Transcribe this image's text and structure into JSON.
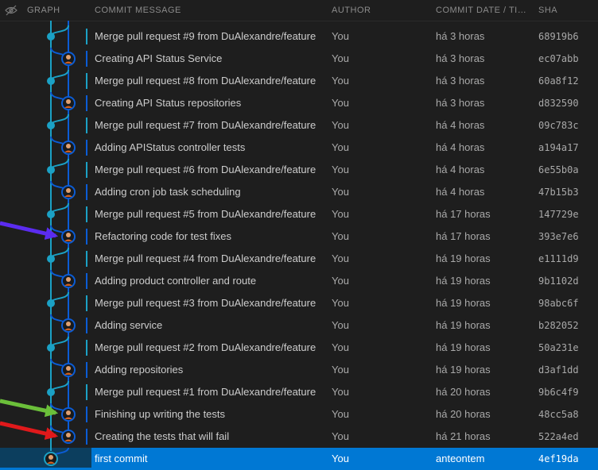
{
  "header": {
    "graph": "GRAPH",
    "message": "COMMIT MESSAGE",
    "author": "AUTHOR",
    "date": "COMMIT DATE / TI…",
    "sha": "SHA"
  },
  "commits": [
    {
      "message": "Merge pull request #9 from DuAlexandre/feature",
      "author": "You",
      "date": "há 3 horas",
      "sha": "68919b6",
      "type": "merge"
    },
    {
      "message": "Creating API Status Service",
      "author": "You",
      "date": "há 3 horas",
      "sha": "ec07abb",
      "type": "commit"
    },
    {
      "message": "Merge pull request #8 from DuAlexandre/feature",
      "author": "You",
      "date": "há 3 horas",
      "sha": "60a8f12",
      "type": "merge"
    },
    {
      "message": "Creating API Status repositories",
      "author": "You",
      "date": "há 3 horas",
      "sha": "d832590",
      "type": "commit"
    },
    {
      "message": "Merge pull request #7 from DuAlexandre/feature",
      "author": "You",
      "date": "há 4 horas",
      "sha": "09c783c",
      "type": "merge"
    },
    {
      "message": "Adding APIStatus controller tests",
      "author": "You",
      "date": "há 4 horas",
      "sha": "a194a17",
      "type": "commit"
    },
    {
      "message": "Merge pull request #6 from DuAlexandre/feature",
      "author": "You",
      "date": "há 4 horas",
      "sha": "6e55b0a",
      "type": "merge"
    },
    {
      "message": "Adding cron job task scheduling",
      "author": "You",
      "date": "há 4 horas",
      "sha": "47b15b3",
      "type": "commit"
    },
    {
      "message": "Merge pull request #5 from DuAlexandre/feature",
      "author": "You",
      "date": "há 17 horas",
      "sha": "147729e",
      "type": "merge"
    },
    {
      "message": "Refactoring code for test fixes",
      "author": "You",
      "date": "há 17 horas",
      "sha": "393e7e6",
      "type": "commit"
    },
    {
      "message": "Merge pull request #4 from DuAlexandre/feature",
      "author": "You",
      "date": "há 19 horas",
      "sha": "e1111d9",
      "type": "merge"
    },
    {
      "message": "Adding product controller and route",
      "author": "You",
      "date": "há 19 horas",
      "sha": "9b1102d",
      "type": "commit"
    },
    {
      "message": "Merge pull request #3 from DuAlexandre/feature",
      "author": "You",
      "date": "há 19 horas",
      "sha": "98abc6f",
      "type": "merge"
    },
    {
      "message": "Adding service",
      "author": "You",
      "date": "há 19 horas",
      "sha": "b282052",
      "type": "commit"
    },
    {
      "message": "Merge pull request #2 from DuAlexandre/feature",
      "author": "You",
      "date": "há 19 horas",
      "sha": "50a231e",
      "type": "merge"
    },
    {
      "message": "Adding repositories",
      "author": "You",
      "date": "há 19 horas",
      "sha": "d3af1dd",
      "type": "commit"
    },
    {
      "message": "Merge pull request #1 from DuAlexandre/feature",
      "author": "You",
      "date": "há 20 horas",
      "sha": "9b6c4f9",
      "type": "merge"
    },
    {
      "message": "Finishing up writing the tests",
      "author": "You",
      "date": "há 20 horas",
      "sha": "48cc5a8",
      "type": "commit"
    },
    {
      "message": "Creating the tests that will fail",
      "author": "You",
      "date": "há 21 horas",
      "sha": "522a4ed",
      "type": "commit"
    },
    {
      "message": "first commit",
      "author": "You",
      "date": "anteontem",
      "sha": "4ef19da",
      "type": "root",
      "selected": true
    }
  ],
  "colors": {
    "main_lane": "#1ba1c5",
    "branch_lane": "#0b5cd5",
    "selection": "#0078d4",
    "arrow_purple": "#5b2cf0",
    "arrow_green": "#6bbf3a",
    "arrow_red": "#e0191b"
  }
}
